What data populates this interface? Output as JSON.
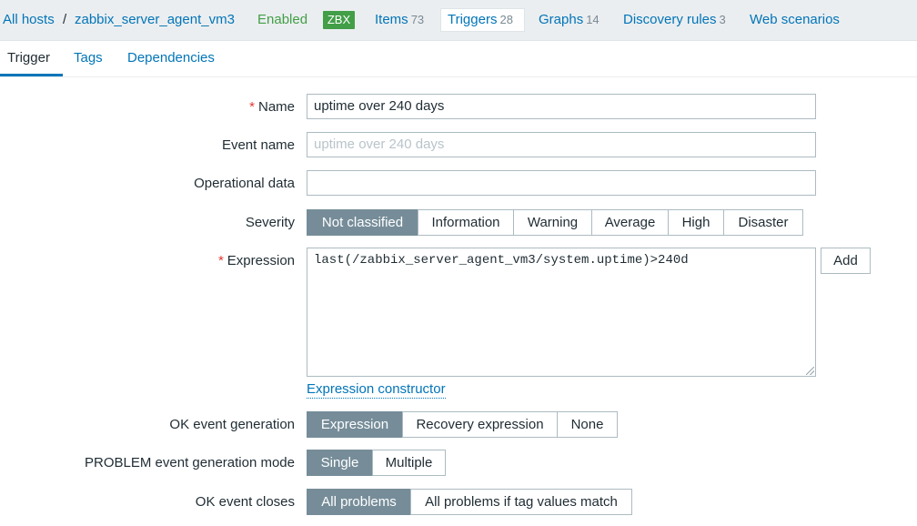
{
  "breadcrumb": {
    "all_hosts": "All hosts",
    "separator": "/",
    "host": "zabbix_server_agent_vm3",
    "status": "Enabled",
    "zbx_badge": "ZBX"
  },
  "host_tabs": [
    {
      "label": "Items",
      "count": "73"
    },
    {
      "label": "Triggers",
      "count": "28"
    },
    {
      "label": "Graphs",
      "count": "14"
    },
    {
      "label": "Discovery rules",
      "count": "3"
    },
    {
      "label": "Web scenarios"
    }
  ],
  "form_tabs": [
    "Trigger",
    "Tags",
    "Dependencies"
  ],
  "form": {
    "name_label": "Name",
    "name_value": "uptime over 240 days",
    "event_name_label": "Event name",
    "event_name_placeholder": "uptime over 240 days",
    "operational_data_label": "Operational data",
    "operational_data_value": "",
    "severity_label": "Severity",
    "severity_options": [
      "Not classified",
      "Information",
      "Warning",
      "Average",
      "High",
      "Disaster"
    ],
    "severity_selected": "Not classified",
    "expression_label": "Expression",
    "expression_value": "last(/zabbix_server_agent_vm3/system.uptime)>240d",
    "add_button": "Add",
    "expression_constructor_link": "Expression constructor",
    "ok_event_generation_label": "OK event generation",
    "ok_event_generation_options": [
      "Expression",
      "Recovery expression",
      "None"
    ],
    "ok_event_generation_selected": "Expression",
    "problem_mode_label": "PROBLEM event generation mode",
    "problem_mode_options": [
      "Single",
      "Multiple"
    ],
    "problem_mode_selected": "Single",
    "ok_event_closes_label": "OK event closes",
    "ok_event_closes_options": [
      "All problems",
      "All problems if tag values match"
    ],
    "ok_event_closes_selected": "All problems"
  },
  "colors": {
    "link": "#0275b8",
    "enabled": "#429e47",
    "selected_segment": "#768d99",
    "required": "#e33734"
  }
}
